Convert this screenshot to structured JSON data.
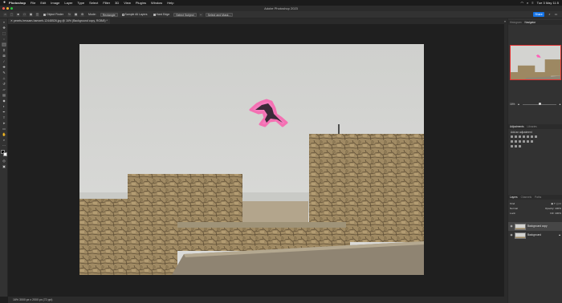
{
  "menubar": {
    "apple": "",
    "items": [
      "Photoshop",
      "File",
      "Edit",
      "Image",
      "Layer",
      "Type",
      "Select",
      "Filter",
      "3D",
      "View",
      "Plugins",
      "Window",
      "Help"
    ],
    "clock": "Tue 3 May 11:5"
  },
  "window": {
    "title": "Adobe Photoshop 2023"
  },
  "options": {
    "object_finder_label": "Object Finder",
    "mode_label": "Mode:",
    "mode_value": "Rectangle",
    "sample_all_layers_label": "Sample All Layers",
    "hard_edge_label": "Hard Edge",
    "select_subject_label": "Select Subject",
    "select_and_mask_label": "Select and Mask...",
    "share_label": "Share"
  },
  "document": {
    "tab_label": "pexels-hessam-hamzeh-12448526.jpg @ 16% (Background copy, RGB/8) *"
  },
  "status": {
    "text": "16%      3000 px x 2000 px (72 ppi)"
  },
  "panels": {
    "top_tabs": [
      "Histogram",
      "Navigator"
    ],
    "zoom": "16%",
    "adjustments_tabs": [
      "Adjustments",
      "Libraries"
    ],
    "adjustments_label": "Add an adjustment",
    "layers_tabs": [
      "Layers",
      "Channels",
      "Paths"
    ],
    "kind_label": "Kind",
    "blend_mode": "Normal",
    "opacity_label": "Opacity: 100%",
    "lock_label": "Lock:",
    "fill_label": "Fill: 100%",
    "layers": [
      {
        "name": "Background copy",
        "selected": true
      },
      {
        "name": "Background",
        "selected": false
      }
    ]
  },
  "colors": {
    "accent": "#1473e6",
    "selection": "#ff5fb8",
    "navigator_frame": "#e03030"
  }
}
